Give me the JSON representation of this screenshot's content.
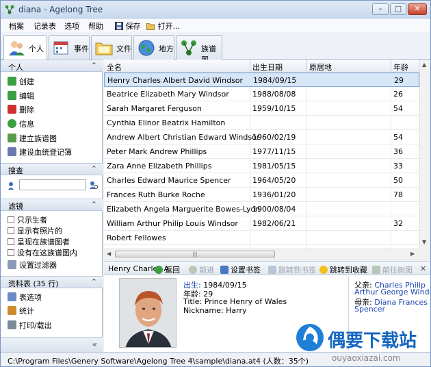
{
  "window": {
    "title": "diana - Agelong Tree",
    "minimize": "–",
    "maximize": "□",
    "close": "✕"
  },
  "menu": {
    "items": [
      "档案",
      "记录表",
      "选项",
      "帮助"
    ],
    "save": "保存",
    "open": "打开..."
  },
  "tabs": [
    {
      "label": "个人",
      "icon": "person-icon"
    },
    {
      "label": "事件",
      "icon": "calendar-icon"
    },
    {
      "label": "文件",
      "icon": "folder-icon"
    },
    {
      "label": "地方",
      "icon": "globe-icon"
    },
    {
      "label": "族谱图",
      "icon": "tree-icon"
    }
  ],
  "left": {
    "person_section": "个人",
    "person_items": [
      "创建",
      "编辑",
      "删除",
      "信息",
      "建立族谱图",
      "建设血统登记簿"
    ],
    "search_section": "搜查",
    "search_value": "",
    "filter_section": "滤镜",
    "filters": [
      "只示生者",
      "显示有照片的",
      "呈现在族谱图者",
      "没有在这族谱图内"
    ],
    "filter_setup": "设置过滤器",
    "datasheet_section": "资料表 (35 行)",
    "datasheet_items": [
      "表选项",
      "统计",
      "打印/载出"
    ],
    "collapse": "«"
  },
  "grid": {
    "columns": [
      "全名",
      "出生日期",
      "原居地",
      "年龄"
    ],
    "rows": [
      {
        "name": "Henry Charles Albert David Windsor",
        "birth": "1984/09/15",
        "place": "",
        "age": "29"
      },
      {
        "name": "Beatrice Elizabeth Mary Windsor",
        "birth": "1988/08/08",
        "place": "",
        "age": "26"
      },
      {
        "name": "Sarah Margaret Ferguson",
        "birth": "1959/10/15",
        "place": "",
        "age": "54"
      },
      {
        "name": "Cynthia Elinor Beatrix Hamilton",
        "birth": "",
        "place": "",
        "age": ""
      },
      {
        "name": "Andrew Albert Christian Edward Windsor",
        "birth": "1960/02/19",
        "place": "",
        "age": "54"
      },
      {
        "name": "Peter Mark Andrew Phillips",
        "birth": "1977/11/15",
        "place": "",
        "age": "36"
      },
      {
        "name": "Zara Anne Elizabeth Phillips",
        "birth": "1981/05/15",
        "place": "",
        "age": "33"
      },
      {
        "name": "Charles Edward Maurice Spencer",
        "birth": "1964/05/20",
        "place": "",
        "age": "50"
      },
      {
        "name": "Frances Ruth Burke Roche",
        "birth": "1936/01/20",
        "place": "",
        "age": "78"
      },
      {
        "name": "Elizabeth Angela Marguerite Bowes-Lyon",
        "birth": "1900/08/04",
        "place": "",
        "age": ""
      },
      {
        "name": "William Arthur Philip Louis Windsor",
        "birth": "1982/06/21",
        "place": "",
        "age": "32"
      },
      {
        "name": "Robert Fellowes",
        "birth": "",
        "place": "",
        "age": ""
      }
    ],
    "hscroll_grip": "|||"
  },
  "person_toolbar": {
    "name": "Henry Charles A",
    "back": "返回",
    "forward": "前进",
    "bookmark": "设置书签",
    "goto_bookmark": "跳转到书签",
    "goto_fav": "跳转到收藏",
    "goto_tree": "前往树图",
    "close": "✕"
  },
  "details": {
    "birth_label": "出生:",
    "birth_value": "1984/09/15",
    "age_label": "年龄:",
    "age_value": "29",
    "title_line": "Title: Prince Henry of Wales",
    "nickname_line": "Nickname: Harry",
    "father_label": "父亲:",
    "father_name1": "Charles Philip",
    "father_name2": "Arthur George Windsor",
    "mother_label": "母亲:",
    "mother_name1": "Diana Frances",
    "mother_name2": "Spencer"
  },
  "status": {
    "text": "C:\\Program Files\\Genery Software\\Agelong Tree 4\\sample\\diana.at4 (人数：35个)"
  },
  "watermark": {
    "title": "偶要下载站",
    "url": "ouyaoxiazai.com"
  },
  "colors": {
    "accent": "#1a45b0",
    "selection": "#d8e7f8"
  }
}
